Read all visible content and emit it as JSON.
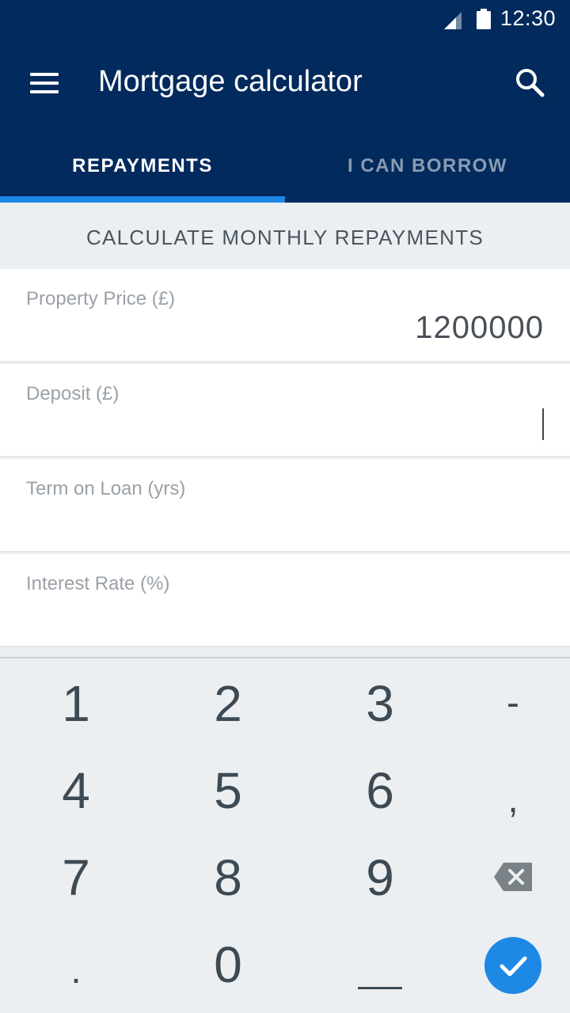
{
  "status_bar": {
    "time": "12:30",
    "signal_icon": "signal-icon",
    "battery_icon": "battery-icon"
  },
  "app_bar": {
    "title": "Mortgage calculator",
    "menu_icon": "menu-icon",
    "search_icon": "search-icon",
    "background": "#022a5c"
  },
  "tabs": [
    {
      "label": "REPAYMENTS",
      "selected": true
    },
    {
      "label": "I CAN BORROW",
      "selected": false
    }
  ],
  "accent_color": "#1e88e5",
  "section_header": "CALCULATE MONTHLY REPAYMENTS",
  "fields": [
    {
      "label": "Property Price (£)",
      "value": "1200000"
    },
    {
      "label": "Deposit (£)",
      "value": "",
      "focused": true
    },
    {
      "label": "Term on Loan (yrs)",
      "value": ""
    },
    {
      "label": "Interest Rate (%)",
      "value": ""
    }
  ],
  "keyboard": {
    "rows": [
      [
        "1",
        "2",
        "3",
        "-"
      ],
      [
        "4",
        "5",
        "6",
        ","
      ],
      [
        "7",
        "8",
        "9",
        "backspace"
      ],
      [
        ".",
        "0",
        "_",
        "done"
      ]
    ],
    "backspace_icon": "backspace-icon",
    "done_icon": "check-icon"
  }
}
